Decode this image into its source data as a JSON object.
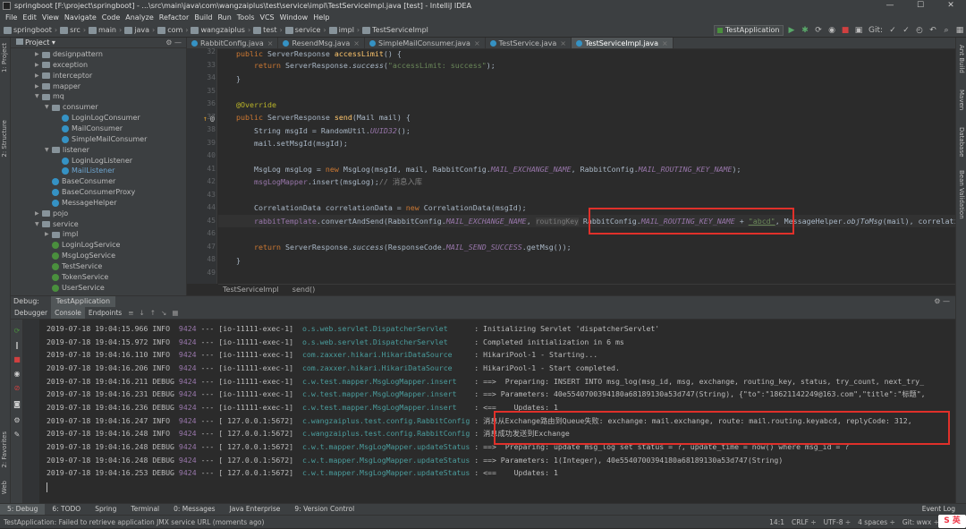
{
  "window": {
    "title": "springboot [F:\\project\\springboot] - ...\\src\\main\\java\\com\\wangzaiplus\\test\\service\\impl\\TestServiceImpl.java [test] - IntelliJ IDEA",
    "min": "—",
    "max": "☐",
    "close": "✕"
  },
  "menu": [
    "File",
    "Edit",
    "View",
    "Navigate",
    "Code",
    "Analyze",
    "Refactor",
    "Build",
    "Run",
    "Tools",
    "VCS",
    "Window",
    "Help"
  ],
  "breadcrumbs": [
    "springboot",
    "src",
    "main",
    "java",
    "com",
    "wangzaiplus",
    "test",
    "service",
    "impl",
    "TestServiceImpl"
  ],
  "run_config": "TestApplication",
  "toolbar_icons": [
    "▶",
    "✱",
    "⟳",
    "◉",
    "■",
    "▣",
    "Git:",
    "✓",
    "✓",
    "◴",
    "↶",
    "⌕",
    "▦",
    "⌕"
  ],
  "left_tabs": [
    "1: Project",
    "2: Structure",
    "2: Favorites",
    "Web"
  ],
  "right_tabs": [
    "Ant Build",
    "Maven",
    "Database",
    "Bean Validation"
  ],
  "project": {
    "header": "Project",
    "nodes": [
      {
        "label": "designpattern",
        "kind": "folder",
        "depth": 3,
        "arrow": "▶"
      },
      {
        "label": "exception",
        "kind": "folder",
        "depth": 3,
        "arrow": "▶"
      },
      {
        "label": "interceptor",
        "kind": "folder",
        "depth": 3,
        "arrow": "▶"
      },
      {
        "label": "mapper",
        "kind": "folder",
        "depth": 3,
        "arrow": "▶"
      },
      {
        "label": "mq",
        "kind": "folder",
        "depth": 3,
        "arrow": "▼"
      },
      {
        "label": "consumer",
        "kind": "folder",
        "depth": 4,
        "arrow": "▼"
      },
      {
        "label": "LoginLogConsumer",
        "kind": "class",
        "depth": 5,
        "arrow": ""
      },
      {
        "label": "MailConsumer",
        "kind": "class",
        "depth": 5,
        "arrow": ""
      },
      {
        "label": "SimpleMailConsumer",
        "kind": "class",
        "depth": 5,
        "arrow": ""
      },
      {
        "label": "listener",
        "kind": "folder",
        "depth": 4,
        "arrow": "▼"
      },
      {
        "label": "LoginLogListener",
        "kind": "class",
        "depth": 5,
        "arrow": ""
      },
      {
        "label": "MailListener",
        "kind": "class",
        "depth": 5,
        "arrow": "",
        "selected": true
      },
      {
        "label": "BaseConsumer",
        "kind": "class",
        "depth": 4,
        "arrow": ""
      },
      {
        "label": "BaseConsumerProxy",
        "kind": "class",
        "depth": 4,
        "arrow": ""
      },
      {
        "label": "MessageHelper",
        "kind": "class",
        "depth": 4,
        "arrow": ""
      },
      {
        "label": "pojo",
        "kind": "folder",
        "depth": 3,
        "arrow": "▶"
      },
      {
        "label": "service",
        "kind": "folder",
        "depth": 3,
        "arrow": "▼"
      },
      {
        "label": "impl",
        "kind": "folder",
        "depth": 4,
        "arrow": "▶"
      },
      {
        "label": "LoginLogService",
        "kind": "intf",
        "depth": 4,
        "arrow": ""
      },
      {
        "label": "MsgLogService",
        "kind": "intf",
        "depth": 4,
        "arrow": ""
      },
      {
        "label": "TestService",
        "kind": "intf",
        "depth": 4,
        "arrow": ""
      },
      {
        "label": "TokenService",
        "kind": "intf",
        "depth": 4,
        "arrow": ""
      },
      {
        "label": "UserService",
        "kind": "intf",
        "depth": 4,
        "arrow": ""
      }
    ]
  },
  "tabs": [
    "RabbitConfig.java",
    "ResendMsg.java",
    "SimpleMailConsumer.java",
    "TestService.java",
    "TestServiceImpl.java"
  ],
  "active_tab": 4,
  "line_numbers": [
    "32",
    "33",
    "34",
    "35",
    "36",
    "37",
    "38",
    "39",
    "40",
    "41",
    "42",
    "43",
    "44",
    "45",
    "46",
    "47",
    "48",
    "49"
  ],
  "editor_breadcrumb": [
    "TestServiceImpl",
    "send()"
  ],
  "debug": {
    "label": "Debug:",
    "app": "TestApplication",
    "gear": "⚙ —"
  },
  "subtools": [
    "Debugger",
    "Console",
    "Endpoints"
  ],
  "logs": [
    [
      "2019-07-18 19:04:15.966",
      "INFO",
      "9424",
      "---",
      "[io-11111-exec-1]",
      "o.s.web.servlet.DispatcherServlet",
      ": Initializing Servlet 'dispatcherServlet'"
    ],
    [
      "2019-07-18 19:04:15.972",
      "INFO",
      "9424",
      "---",
      "[io-11111-exec-1]",
      "o.s.web.servlet.DispatcherServlet",
      ": Completed initialization in 6 ms"
    ],
    [
      "2019-07-18 19:04:16.110",
      "INFO",
      "9424",
      "---",
      "[io-11111-exec-1]",
      "com.zaxxer.hikari.HikariDataSource",
      ": HikariPool-1 - Starting..."
    ],
    [
      "2019-07-18 19:04:16.206",
      "INFO",
      "9424",
      "---",
      "[io-11111-exec-1]",
      "com.zaxxer.hikari.HikariDataSource",
      ": HikariPool-1 - Start completed."
    ],
    [
      "2019-07-18 19:04:16.211",
      "DEBUG",
      "9424",
      "---",
      "[io-11111-exec-1]",
      "c.w.test.mapper.MsgLogMapper.insert",
      ": ==>  Preparing: INSERT INTO msg_log(msg_id, msg, exchange, routing_key, status, try_count, next_try_"
    ],
    [
      "2019-07-18 19:04:16.231",
      "DEBUG",
      "9424",
      "---",
      "[io-11111-exec-1]",
      "c.w.test.mapper.MsgLogMapper.insert",
      ": ==> Parameters: 40e5540700394180a68189130a53d747(String), {\"to\":\"18621142249@163.com\",\"title\":\"标题\","
    ],
    [
      "2019-07-18 19:04:16.236",
      "DEBUG",
      "9424",
      "---",
      "[io-11111-exec-1]",
      "c.w.test.mapper.MsgLogMapper.insert",
      ": <==    Updates: 1"
    ],
    [
      "2019-07-18 19:04:16.247",
      "INFO",
      "9424",
      "---",
      "[ 127.0.0.1:5672]",
      "c.wangzaiplus.test.config.RabbitConfig",
      ": 消息从Exchange路由到Queue失败: exchange: mail.exchange, route: mail.routing.keyabcd, replyCode: 312,"
    ],
    [
      "2019-07-18 19:04:16.248",
      "INFO",
      "9424",
      "---",
      "[ 127.0.0.1:5672]",
      "c.wangzaiplus.test.config.RabbitConfig",
      ": 消息成功发送到Exchange"
    ],
    [
      "2019-07-18 19:04:16.248",
      "DEBUG",
      "9424",
      "---",
      "[ 127.0.0.1:5672]",
      "c.w.t.mapper.MsgLogMapper.updateStatus",
      ": ==>  Preparing: update msg_log set status = ?, update_time = now() where msg_id = ?"
    ],
    [
      "2019-07-18 19:04:16.248",
      "DEBUG",
      "9424",
      "---",
      "[ 127.0.0.1:5672]",
      "c.w.t.mapper.MsgLogMapper.updateStatus",
      ": ==> Parameters: 1(Integer), 40e5540700394180a68189130a53d747(String)"
    ],
    [
      "2019-07-18 19:04:16.253",
      "DEBUG",
      "9424",
      "---",
      "[ 127.0.0.1:5672]",
      "c.w.t.mapper.MsgLogMapper.updateStatus",
      ": <==    Updates: 1"
    ]
  ],
  "bottom_tabs": [
    "5: Debug",
    "6: TODO",
    "Spring",
    "Terminal",
    "0: Messages",
    "Java Enterprise",
    "9: Version Control"
  ],
  "event_log": "Event Log",
  "status": {
    "message": "TestApplication: Failed to retrieve application JMX service URL (moments ago)",
    "pos": "14:1",
    "crlf": "CRLF ÷",
    "enc": "UTF-8 ÷",
    "indent": "4 spaces ÷",
    "git": "Git: wwx ÷"
  },
  "ime": "S 英",
  "code_hint": "routingKey"
}
